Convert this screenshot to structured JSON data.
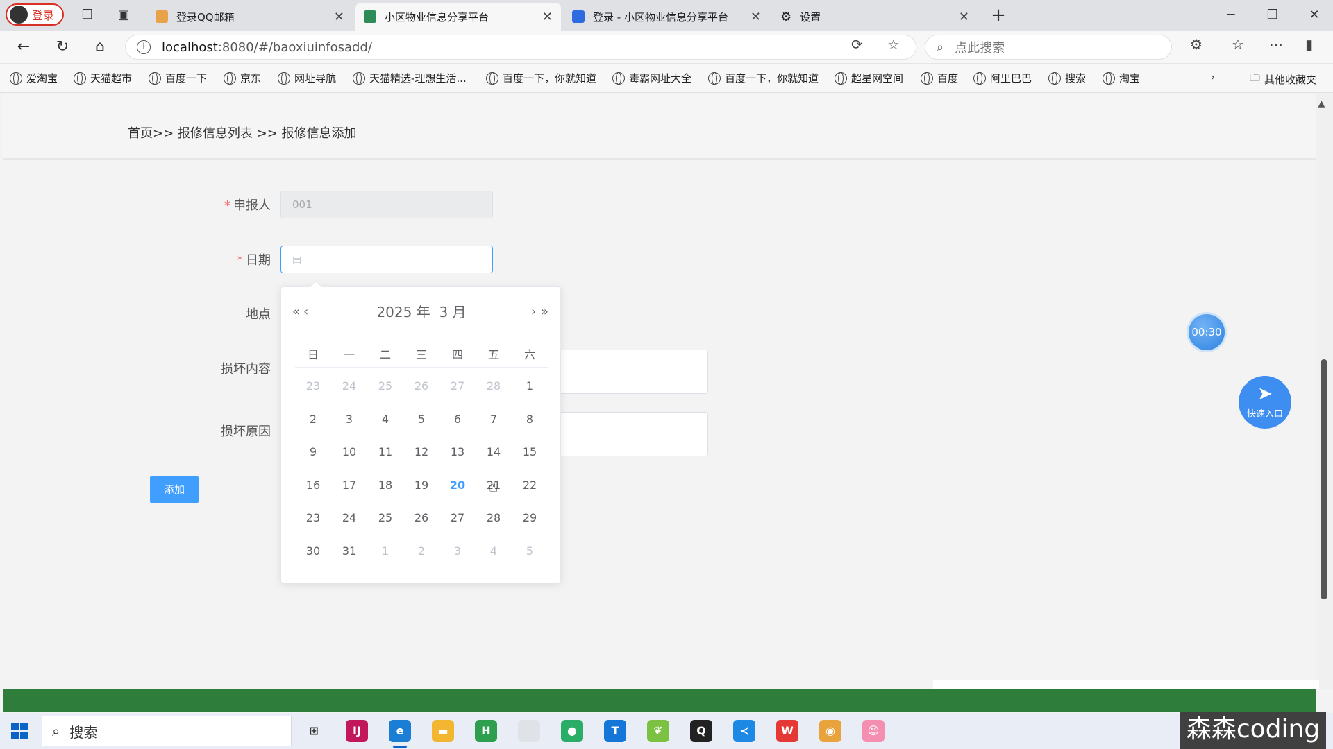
{
  "browser": {
    "profile_label": "登录",
    "tabs": [
      {
        "title": "登录QQ邮箱",
        "icon": "qq-mail-icon",
        "color": "#e8a24a"
      },
      {
        "title": "小区物业信息分享平台",
        "icon": "vue-icon",
        "color": "#2e8b57"
      },
      {
        "title": "登录 - 小区物业信息分享平台",
        "icon": "paypal-style-icon",
        "color": "#2d6be0"
      },
      {
        "title": "设置",
        "icon": "gear-icon",
        "color": "#444"
      }
    ],
    "url_host": "localhost",
    "url_path": ":8080/#/baoxiuinfosadd/",
    "search_placeholder": "点此搜索",
    "bookmarks": [
      "爱淘宝",
      "天猫超市",
      "百度一下",
      "京东",
      "网址导航",
      "天猫精选-理想生活...",
      "百度一下，你就知道",
      "毒霸网址大全",
      "百度一下，你就知道",
      "超星网空间",
      "百度",
      "阿里巴巴",
      "搜索",
      "淘宝"
    ],
    "other_bookmarks": "其他收藏夹"
  },
  "page": {
    "breadcrumb": "首页>> 报修信息列表 >> 报修信息添加",
    "form": {
      "reporter_label": "申报人",
      "reporter_value": "001",
      "date_label": "日期",
      "location_label": "地点",
      "damage_content_label": "损坏内容",
      "damage_reason_label": "损坏原因",
      "add_button": "添加"
    },
    "datepicker": {
      "year_label": "2025 年",
      "month_label": "3 月",
      "weekdays": [
        "日",
        "一",
        "二",
        "三",
        "四",
        "五",
        "六"
      ],
      "days": [
        {
          "d": "23",
          "o": true
        },
        {
          "d": "24",
          "o": true
        },
        {
          "d": "25",
          "o": true
        },
        {
          "d": "26",
          "o": true
        },
        {
          "d": "27",
          "o": true
        },
        {
          "d": "28",
          "o": true
        },
        {
          "d": "1"
        },
        {
          "d": "2"
        },
        {
          "d": "3"
        },
        {
          "d": "4"
        },
        {
          "d": "5"
        },
        {
          "d": "6"
        },
        {
          "d": "7"
        },
        {
          "d": "8"
        },
        {
          "d": "9"
        },
        {
          "d": "10"
        },
        {
          "d": "11"
        },
        {
          "d": "12"
        },
        {
          "d": "13"
        },
        {
          "d": "14"
        },
        {
          "d": "15"
        },
        {
          "d": "16"
        },
        {
          "d": "17"
        },
        {
          "d": "18"
        },
        {
          "d": "19"
        },
        {
          "d": "20",
          "t": true
        },
        {
          "d": "21"
        },
        {
          "d": "22"
        },
        {
          "d": "23"
        },
        {
          "d": "24"
        },
        {
          "d": "25"
        },
        {
          "d": "26"
        },
        {
          "d": "27"
        },
        {
          "d": "28"
        },
        {
          "d": "29"
        },
        {
          "d": "30"
        },
        {
          "d": "31"
        },
        {
          "d": "1",
          "o": true
        },
        {
          "d": "2",
          "o": true
        },
        {
          "d": "3",
          "o": true
        },
        {
          "d": "4",
          "o": true
        },
        {
          "d": "5",
          "o": true
        }
      ]
    },
    "timer": "00:30",
    "quick_entry": "快速入口"
  },
  "taskbar": {
    "search_label": "搜索",
    "apps": [
      {
        "name": "task-view-icon",
        "color": "#e9eef6",
        "glyph": "⊞"
      },
      {
        "name": "intellij-icon",
        "color": "#c2185b",
        "glyph": "IJ"
      },
      {
        "name": "edge-icon",
        "color": "#1a7fd4",
        "glyph": "e"
      },
      {
        "name": "file-explorer-icon",
        "color": "#f2b630",
        "glyph": "▬"
      },
      {
        "name": "hbuilder-icon",
        "color": "#2e9e4f",
        "glyph": "H"
      },
      {
        "name": "notepad-icon",
        "color": "#dfe3e8",
        "glyph": ""
      },
      {
        "name": "wechat-icon",
        "color": "#2aae67",
        "glyph": "●"
      },
      {
        "name": "feishu-icon",
        "color": "#1476d8",
        "glyph": "T"
      },
      {
        "name": "leaf-app-icon",
        "color": "#7cc242",
        "glyph": "❦"
      },
      {
        "name": "qq-icon",
        "color": "#222",
        "glyph": "Q"
      },
      {
        "name": "vscode-icon",
        "color": "#1e88e5",
        "glyph": "≺"
      },
      {
        "name": "wps-icon",
        "color": "#e53935",
        "glyph": "W"
      },
      {
        "name": "chrome-icon",
        "color": "#e8a33d",
        "glyph": "◉"
      },
      {
        "name": "avatar-app-icon",
        "color": "#f48fb1",
        "glyph": "☺"
      }
    ],
    "watermark": "森森coding"
  }
}
